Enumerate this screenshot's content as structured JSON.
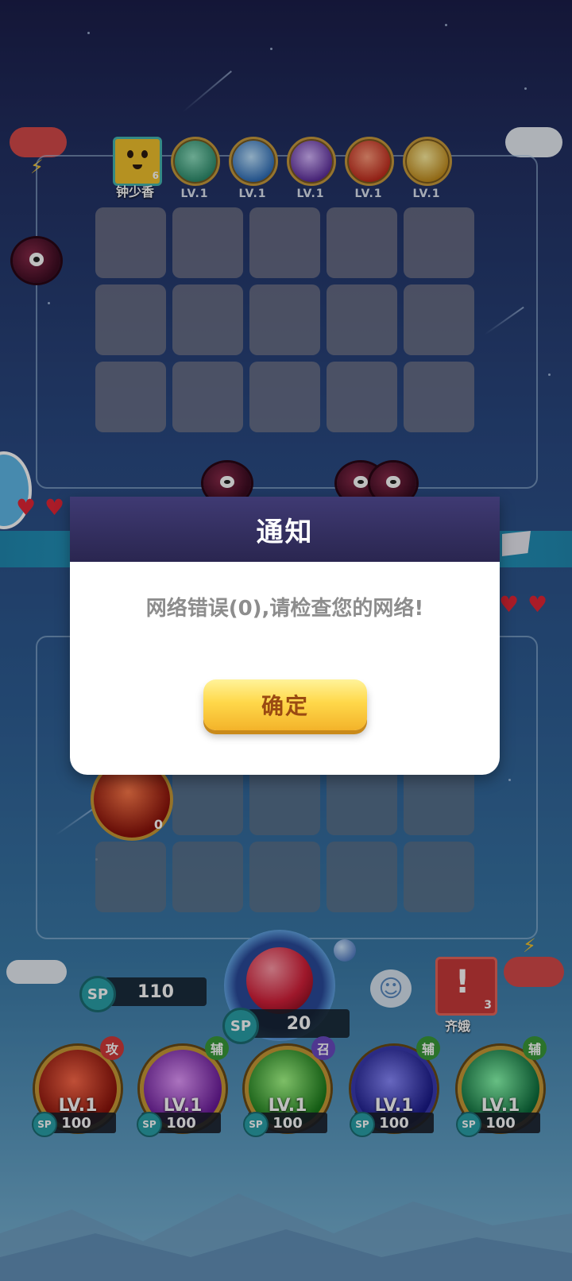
{
  "top_player": {
    "name": "钟少香",
    "level": "6",
    "skills": [
      {
        "icon": "dragon-icon",
        "level": "LV.1",
        "color": "#3fb08a"
      },
      {
        "icon": "wave-icon",
        "level": "LV.1",
        "color": "#3a8ad6"
      },
      {
        "icon": "butterfly-icon",
        "level": "LV.1",
        "color": "#8a5ad0"
      },
      {
        "icon": "red-monster-icon",
        "level": "LV.1",
        "color": "#e0402a"
      },
      {
        "icon": "amber-orb-icon",
        "level": "LV.1",
        "color": "#e0b03a"
      }
    ]
  },
  "bottom_player": {
    "name": "齐娥",
    "level": "3",
    "sp_total": "110",
    "summon_cost": "20",
    "field_unit_level": "0"
  },
  "dialog": {
    "title": "通知",
    "message": "网络错误(0),请检查您的网络!",
    "confirm_label": "确定"
  },
  "sp_label": "SP",
  "skills": [
    {
      "level": "LV.1",
      "tag": "攻",
      "tag_color": "#d23a3a",
      "cost": "100",
      "color": "#b3261e",
      "icon": "trident-icon"
    },
    {
      "level": "LV.1",
      "tag": "辅",
      "tag_color": "#3a9a3a",
      "cost": "100",
      "color": "#9a3ab0",
      "icon": "figures-icon"
    },
    {
      "level": "LV.1",
      "tag": "召",
      "tag_color": "#6a4ac0",
      "cost": "100",
      "color": "#3aa03a",
      "icon": "star-burst-icon"
    },
    {
      "level": "LV.1",
      "tag": "辅",
      "tag_color": "#3a9a3a",
      "cost": "100",
      "color": "#3a3ac0",
      "icon": "swap-arrows-icon"
    },
    {
      "level": "LV.1",
      "tag": "辅",
      "tag_color": "#3a9a3a",
      "cost": "100",
      "color": "#2a9a5a",
      "icon": "up-arrow-icon"
    }
  ]
}
